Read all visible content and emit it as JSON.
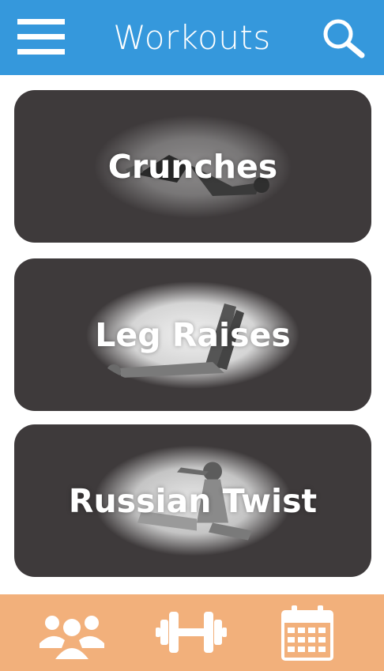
{
  "header": {
    "title": "Workouts",
    "background": "#3598dc",
    "menu_icon": "hamburger-menu-icon",
    "search_icon": "search-icon"
  },
  "workouts": [
    {
      "label": "Crunches",
      "icon": "crunches-photo"
    },
    {
      "label": "Leg Raises",
      "icon": "leg-raises-photo"
    },
    {
      "label": "Russian Twist",
      "icon": "russian-twist-photo"
    }
  ],
  "card_color": "#3e3a3b",
  "bottom_nav": {
    "background": "#f2b07b",
    "items": [
      {
        "icon": "community-icon"
      },
      {
        "icon": "dumbbell-icon"
      },
      {
        "icon": "calendar-icon"
      }
    ]
  }
}
